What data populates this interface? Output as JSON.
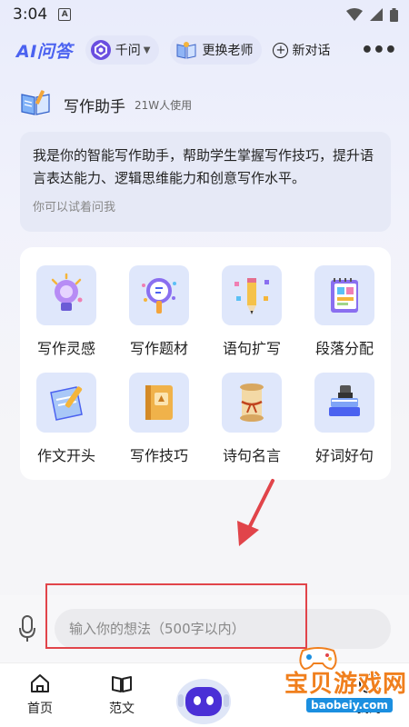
{
  "status_bar": {
    "time": "3:04",
    "notif_letter": "A"
  },
  "header": {
    "logo": "AI问答",
    "model_label": "千问",
    "change_teacher_label": "更换老师",
    "new_chat_label": "新对话"
  },
  "assistant": {
    "name": "写作助手",
    "usage": "21W人使用",
    "intro": "我是你的智能写作助手，帮助学生掌握写作技巧，提升语言表达能力、逻辑思维能力和创意写作水平。",
    "hint": "你可以试着问我"
  },
  "tools": [
    {
      "label": "写作灵感",
      "icon": "lightbulb-icon"
    },
    {
      "label": "写作题材",
      "icon": "magnifier-icon"
    },
    {
      "label": "语句扩写",
      "icon": "pencil-icon"
    },
    {
      "label": "段落分配",
      "icon": "notebook-icon"
    },
    {
      "label": "作文开头",
      "icon": "paper-pen-icon"
    },
    {
      "label": "写作技巧",
      "icon": "book-icon"
    },
    {
      "label": "诗句名言",
      "icon": "scroll-icon"
    },
    {
      "label": "好词好句",
      "icon": "books-stack-icon"
    }
  ],
  "input": {
    "placeholder": "输入你的想法（500字以内）"
  },
  "nav": {
    "home": "首页",
    "essay": "范文",
    "mine": "我的"
  },
  "watermark": {
    "title": "宝贝游戏网",
    "url": "baobeiy.com"
  },
  "colors": {
    "accent": "#4b62f0",
    "annotation": "#e1444a",
    "tool_bg": "#dfe7fb"
  }
}
